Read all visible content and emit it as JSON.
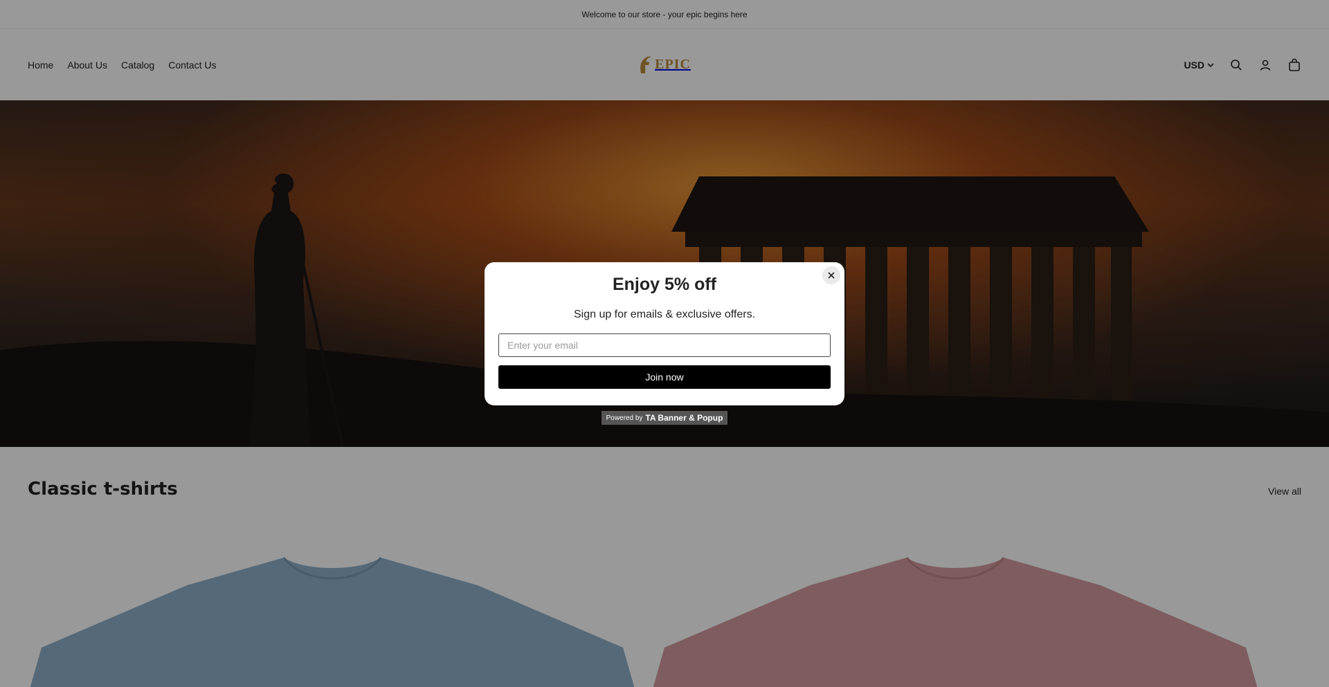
{
  "announcement": {
    "text": "Welcome to our store - your epic begins here"
  },
  "header": {
    "nav": [
      {
        "label": "Home"
      },
      {
        "label": "About Us"
      },
      {
        "label": "Catalog"
      },
      {
        "label": "Contact Us"
      }
    ],
    "logo_text": "EPIC",
    "currency": "USD",
    "icons": [
      "search-icon",
      "account-icon",
      "cart-icon"
    ]
  },
  "section": {
    "title": "Classic t-shirts",
    "view_all": "View all",
    "products": [
      {
        "color": "#8fb0c9"
      },
      {
        "color": "#d39a9e"
      }
    ]
  },
  "popup": {
    "title": "Enjoy 5% off",
    "subtitle": "Sign up for emails & exclusive offers.",
    "email_placeholder": "Enter your email",
    "button": "Join now",
    "powered_prefix": "Powered by",
    "powered_brand": "TA Banner & Popup"
  }
}
